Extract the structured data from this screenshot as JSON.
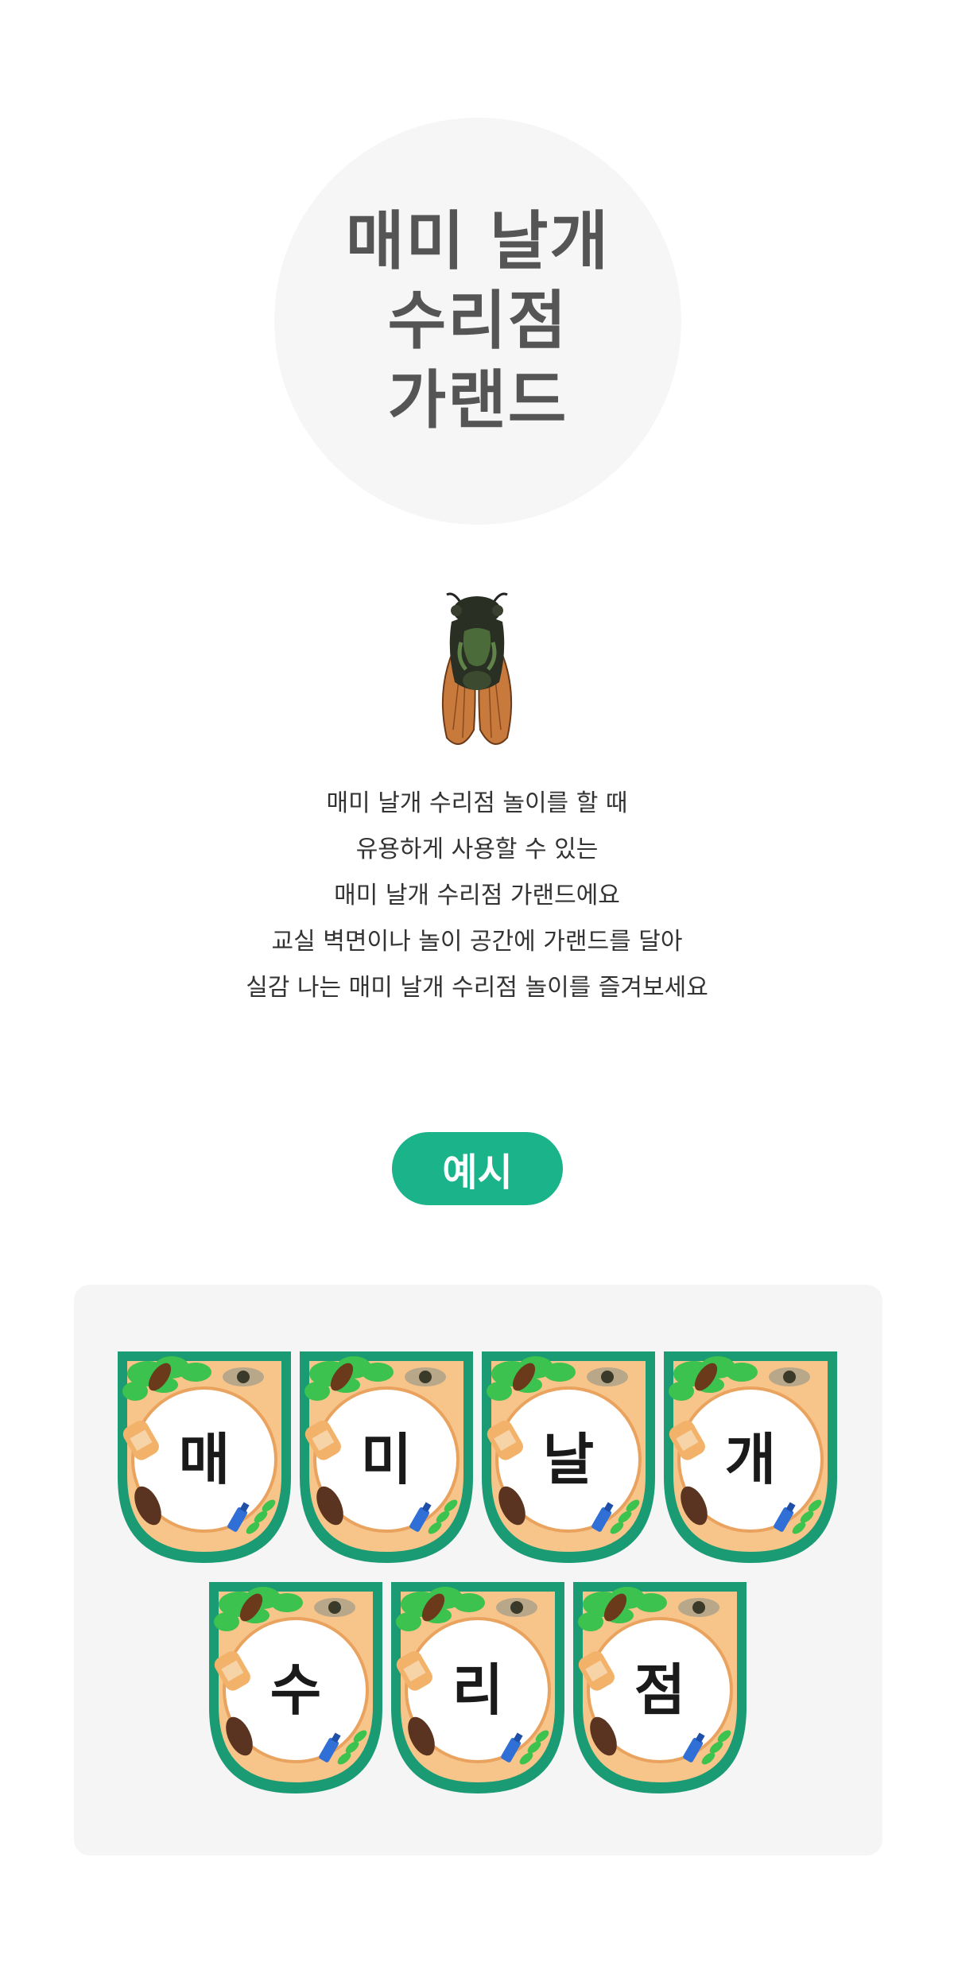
{
  "hero": {
    "title_lines": [
      "매미 날개",
      "수리점",
      "가랜드"
    ]
  },
  "description": {
    "lines": [
      "매미 날개 수리점 놀이를 할 때",
      "유용하게 사용할 수 있는",
      "매미 날개 수리점 가랜드에요",
      "교실 벽면이나 놀이 공간에 가랜드를 달아",
      "실감 나는 매미 날개 수리점 놀이를 즐겨보세요"
    ]
  },
  "example": {
    "label": "예시",
    "pennants": [
      "매",
      "미",
      "날",
      "개",
      "수",
      "리",
      "점"
    ]
  },
  "colors": {
    "accent": "#1bb38a",
    "pennant_border": "#1a9b74",
    "pennant_inner": "#f7c48a",
    "leaf": "#3cc24e",
    "hero_bg": "#f6f6f6",
    "box_bg": "#f5f5f5"
  },
  "icons": [
    "cicada-icon",
    "leaf-icon",
    "moth-icon",
    "glue-icon",
    "bandage-icon"
  ]
}
